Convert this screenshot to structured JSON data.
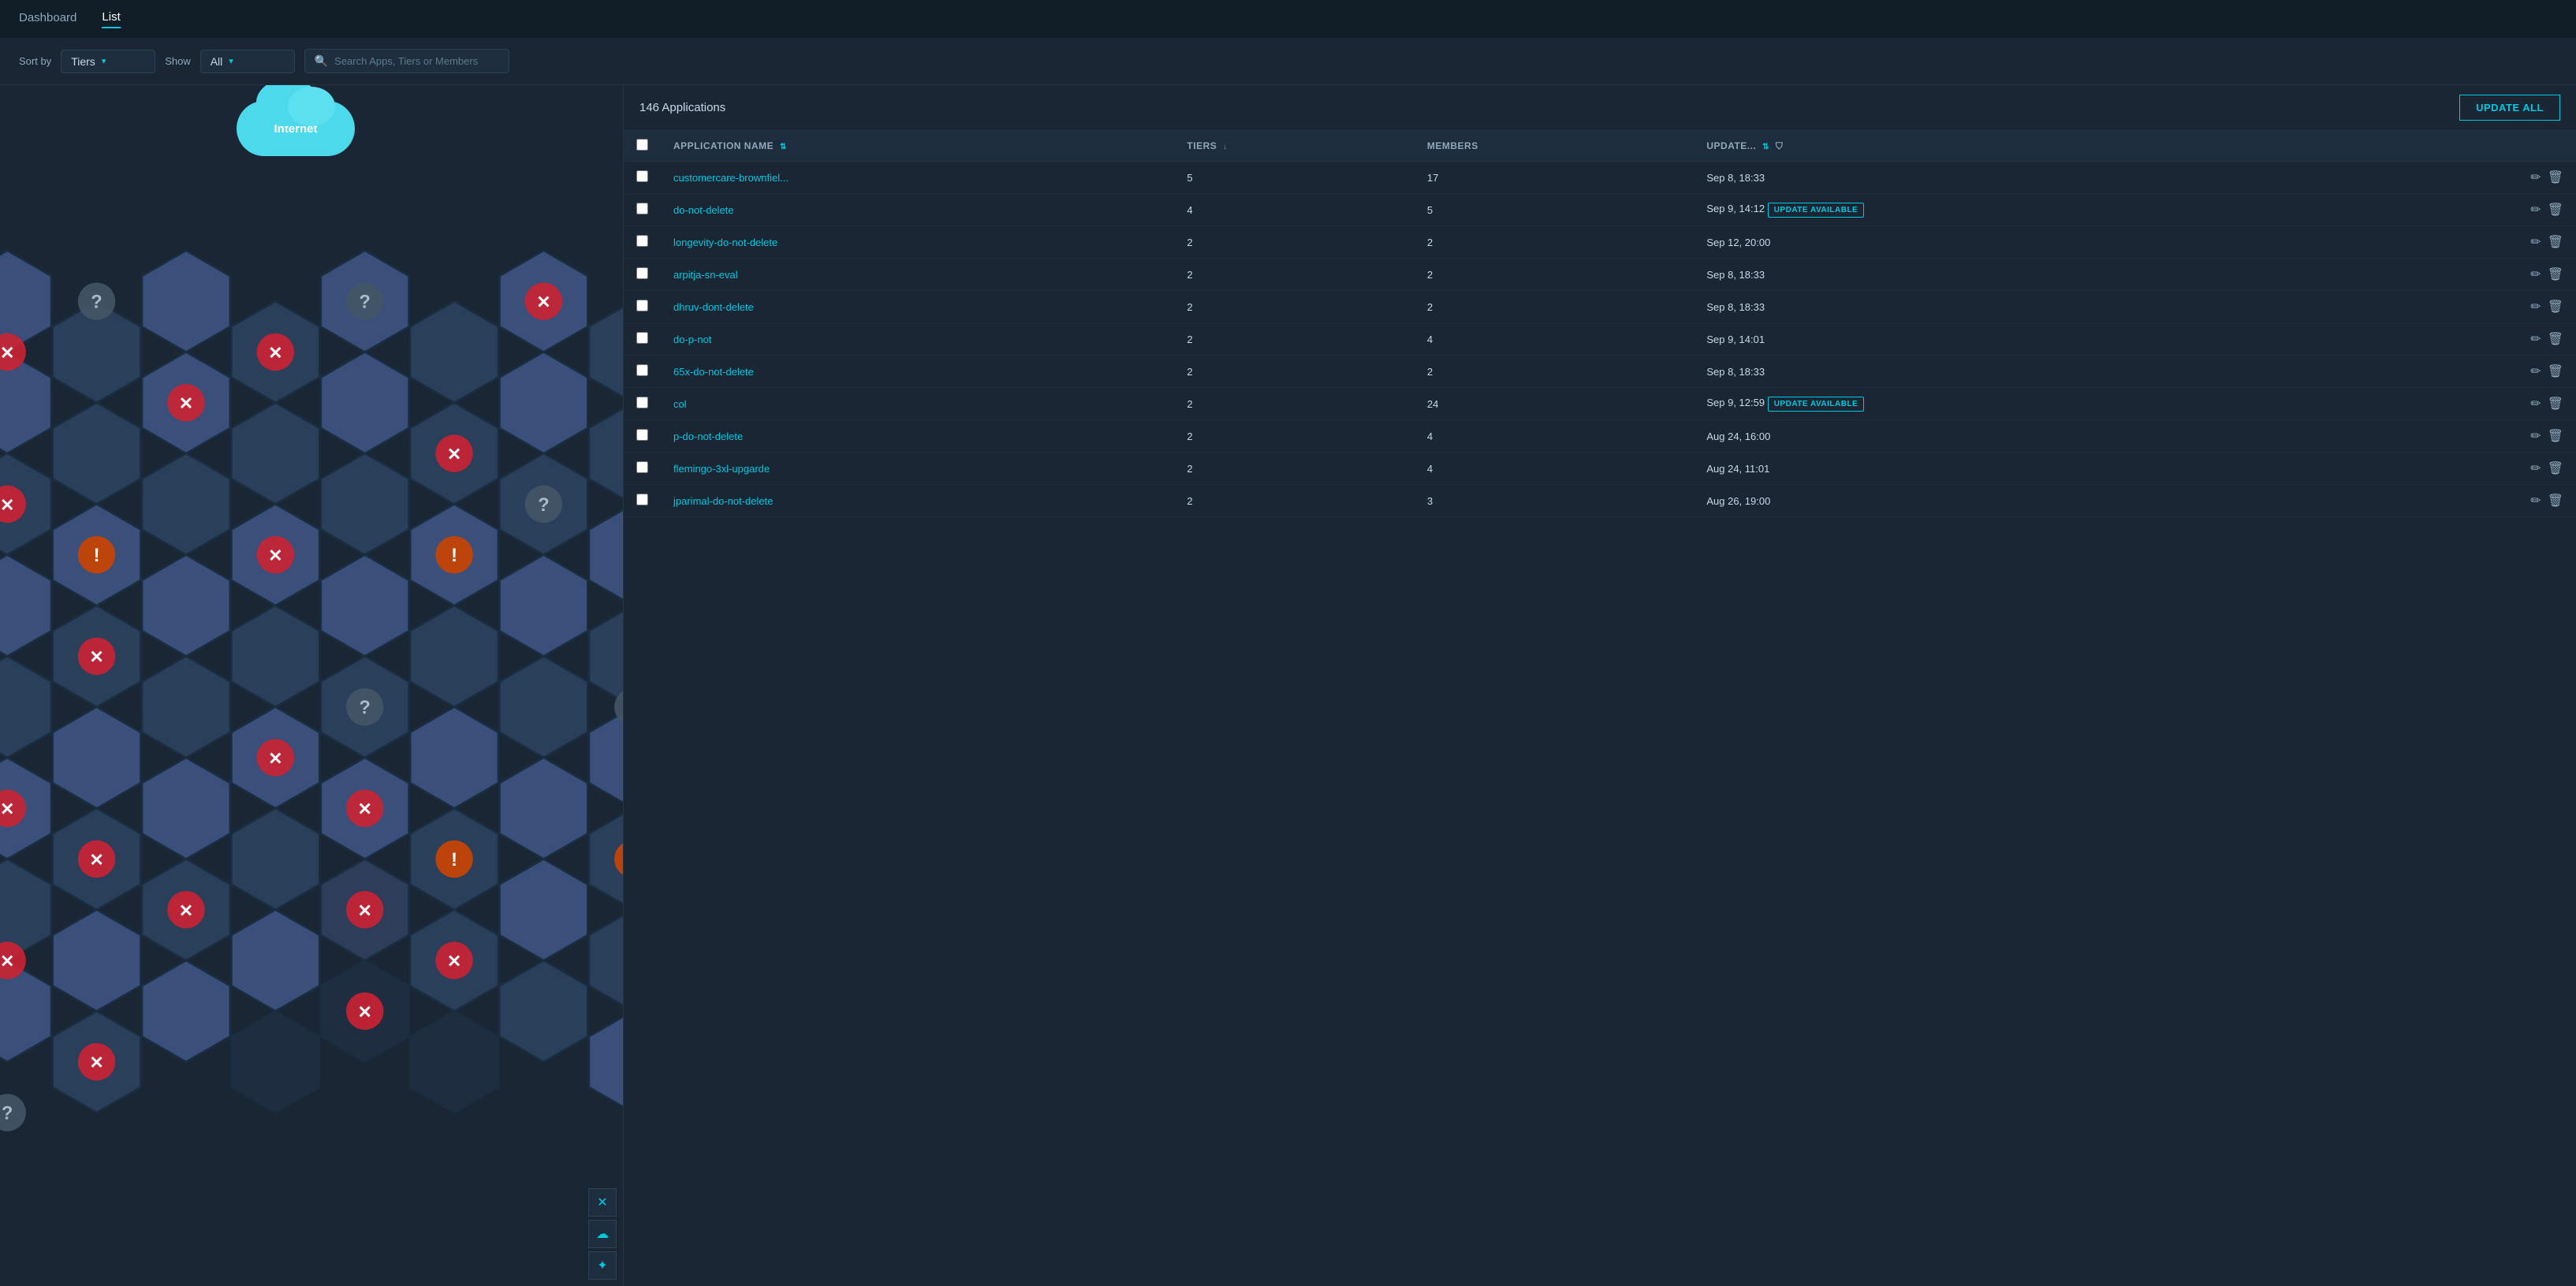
{
  "nav": {
    "items": [
      {
        "label": "Dashboard",
        "active": false
      },
      {
        "label": "List",
        "active": true
      }
    ]
  },
  "toolbar": {
    "sort_by_label": "Sort by",
    "sort_by_value": "Tiers",
    "show_label": "Show",
    "show_value": "All",
    "search_placeholder": "Search Apps, Tiers or Members"
  },
  "map": {
    "cloud_label": "Internet",
    "action_buttons": [
      "×",
      "☁",
      "✦"
    ]
  },
  "list": {
    "count_label": "146 Applications",
    "update_all_label": "UPDATE ALL",
    "columns": [
      {
        "label": "Application Name",
        "sortable": true
      },
      {
        "label": "Tiers",
        "sortable": true
      },
      {
        "label": "Members",
        "sortable": false
      },
      {
        "label": "Update...",
        "sortable": true,
        "filterable": true
      }
    ],
    "rows": [
      {
        "name": "customercare-brownfiel...",
        "tiers": 5,
        "members": 17,
        "updated": "Sep 8, 18:33",
        "update_available": false
      },
      {
        "name": "do-not-delete",
        "tiers": 4,
        "members": 5,
        "updated": "Sep 9, 14:12",
        "update_available": true
      },
      {
        "name": "longevity-do-not-delete",
        "tiers": 2,
        "members": 2,
        "updated": "Sep 12, 20:00",
        "update_available": false
      },
      {
        "name": "arpitja-sn-eval",
        "tiers": 2,
        "members": 2,
        "updated": "Sep 8, 18:33",
        "update_available": false
      },
      {
        "name": "dhruv-dont-delete",
        "tiers": 2,
        "members": 2,
        "updated": "Sep 8, 18:33",
        "update_available": false
      },
      {
        "name": "do-p-not",
        "tiers": 2,
        "members": 4,
        "updated": "Sep 9, 14:01",
        "update_available": false
      },
      {
        "name": "65x-do-not-delete",
        "tiers": 2,
        "members": 2,
        "updated": "Sep 8, 18:33",
        "update_available": false
      },
      {
        "name": "col",
        "tiers": 2,
        "members": 24,
        "updated": "Sep 9, 12:59",
        "update_available": true
      },
      {
        "name": "p-do-not-delete",
        "tiers": 2,
        "members": 4,
        "updated": "Aug 24, 16:00",
        "update_available": false
      },
      {
        "name": "flemingo-3xl-upgarde",
        "tiers": 2,
        "members": 4,
        "updated": "Aug 24, 11:01",
        "update_available": false
      },
      {
        "name": "jparimal-do-not-delete",
        "tiers": 2,
        "members": 3,
        "updated": "Aug 26, 19:00",
        "update_available": false
      }
    ],
    "update_available_label": "UPDATE AVAILABLE"
  }
}
